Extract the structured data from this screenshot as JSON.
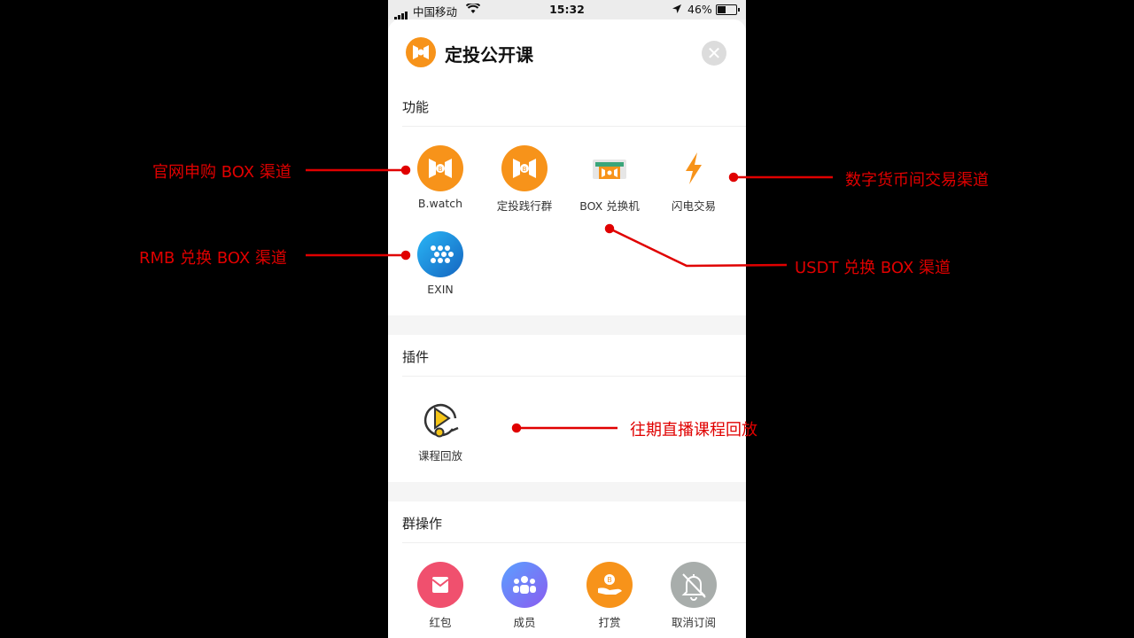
{
  "status_bar": {
    "carrier": "中国移动",
    "time": "15:32",
    "battery": "46%",
    "battery_level": 0.46
  },
  "sheet": {
    "title": "定投公开课",
    "close_icon": "close-icon"
  },
  "sections": {
    "functions": {
      "label": "功能",
      "items": [
        "B.watch",
        "定投践行群",
        "BOX 兑换机",
        "闪电交易",
        "EXIN"
      ]
    },
    "plugins": {
      "label": "插件",
      "items": [
        "课程回放"
      ]
    },
    "group_ops": {
      "label": "群操作",
      "items": [
        "红包",
        "成员",
        "打赏",
        "取消订阅"
      ]
    }
  },
  "annotations": {
    "bwatch": "官网申购 BOX 渠道",
    "flash": "数字货币间交易渠道",
    "exin": "RMB 兑换 BOX 渠道",
    "box_exchanger": "USDT 兑换 BOX 渠道",
    "replay": "往期直播课程回放"
  },
  "colors": {
    "annotation": "#e00000",
    "accent": "#f7931a",
    "exin": "#1e88e5",
    "red_packet": "#f0506e",
    "members": "#6a7cf0"
  }
}
